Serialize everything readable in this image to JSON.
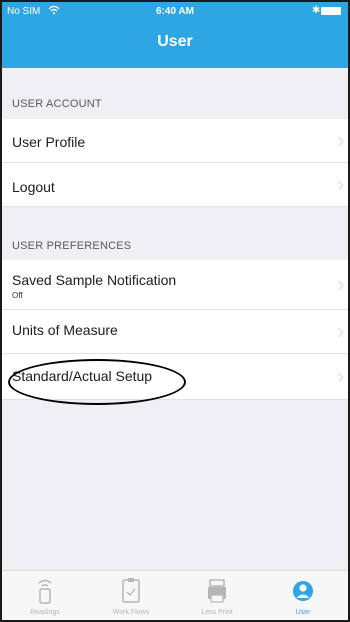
{
  "status_bar": {
    "carrier": "No SIM",
    "time": "6:40 AM"
  },
  "nav": {
    "title": "User"
  },
  "sections": [
    {
      "header": "USER ACCOUNT",
      "rows": [
        {
          "label": "User Profile"
        },
        {
          "label": "Logout"
        }
      ]
    },
    {
      "header": "USER PREFERENCES",
      "rows": [
        {
          "label": "Saved Sample Notification",
          "sub": "Off"
        },
        {
          "label": "Units of Measure"
        },
        {
          "label": "Standard/Actual Setup"
        }
      ]
    }
  ],
  "tabbar": {
    "tabs": [
      {
        "label": "Readings",
        "icon": "sensor-icon",
        "active": false
      },
      {
        "label": "Work Flows",
        "icon": "clipboard-icon",
        "active": false
      },
      {
        "label": "Less Print",
        "icon": "printer-icon",
        "active": false
      },
      {
        "label": "User",
        "icon": "user-icon",
        "active": true
      }
    ]
  },
  "colors": {
    "accent": "#2ea6e3",
    "background": "#efeff4",
    "inactive_tab": "#b5b5b5"
  }
}
